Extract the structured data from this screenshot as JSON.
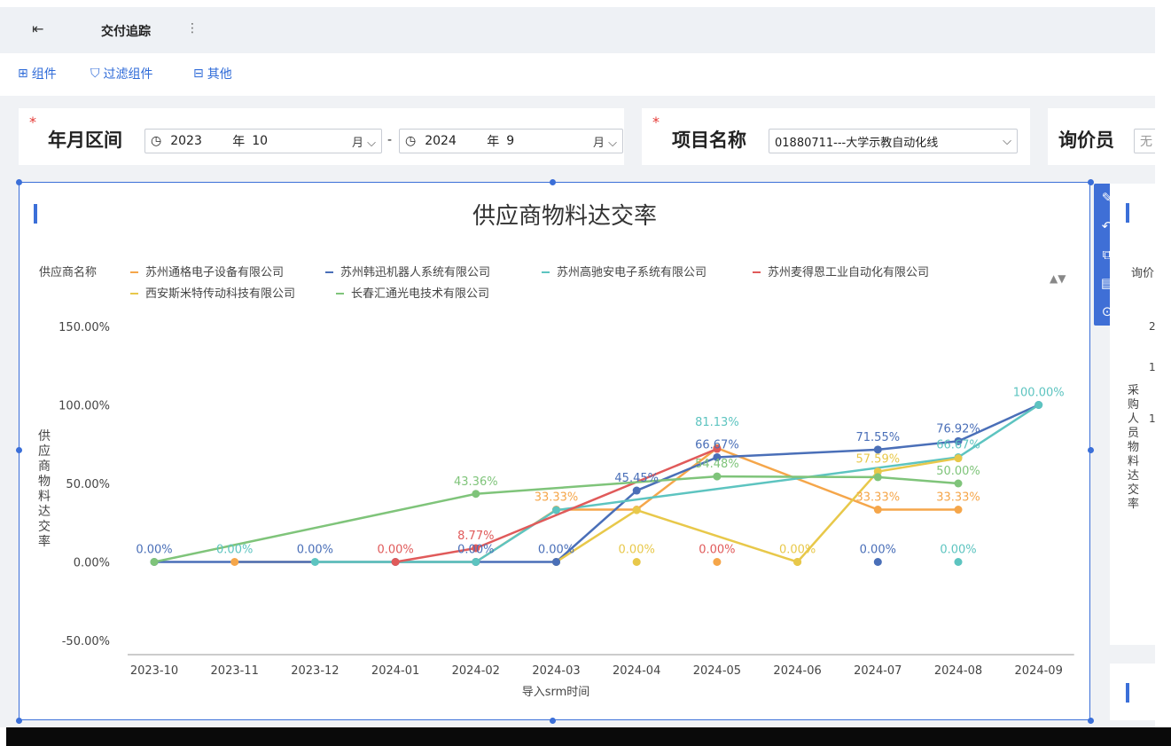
{
  "titlebar": {
    "back_icon": "exit-icon",
    "tab": "交付追踪",
    "more": "⋮"
  },
  "toolbar": {
    "items": [
      "组件",
      "过滤组件",
      "其他"
    ]
  },
  "filters": {
    "date": {
      "label": "年月区间",
      "start_year": "2023",
      "year_unit": "年",
      "start_month": "10",
      "month_unit": "月",
      "separator": "-",
      "end_year": "2024",
      "end_month": "9"
    },
    "project": {
      "label": "项目名称",
      "value": "01880711---大学示教自动化线"
    },
    "inquirer": {
      "label": "询价员",
      "placeholder": "无"
    }
  },
  "side_tools": [
    "edit-icon",
    "undo-icon",
    "copy-icon",
    "comment-icon",
    "collapse-icon"
  ],
  "right_card": {
    "label_short": "询价",
    "vertical_label": "采购人员物料达交率",
    "ticks": [
      "2",
      "1",
      "1"
    ]
  },
  "chart_data": {
    "type": "line",
    "title": "供应商物料达交率",
    "legend_title": "供应商名称",
    "xlabel": "导入srm时间",
    "ylabel": "供应商物料达交率",
    "categories": [
      "2023-10",
      "2023-11",
      "2023-12",
      "2024-01",
      "2024-02",
      "2024-03",
      "2024-04",
      "2024-05",
      "2024-06",
      "2024-07",
      "2024-08",
      "2024-09"
    ],
    "yticks": [
      "150.00%",
      "100.00%",
      "50.00%",
      "0.00%",
      "-50.00%"
    ],
    "ylim": [
      -50,
      150
    ],
    "grid": false,
    "legend_position": "top",
    "series": [
      {
        "name": "苏州通格电子设备有限公司",
        "color": "#f5a64a",
        "values": [
          null,
          0,
          null,
          null,
          0,
          33.33,
          33.33,
          72.5,
          null,
          33.33,
          33.33,
          null
        ]
      },
      {
        "name": "苏州韩迅机器人系统有限公司",
        "color": "#4a6fb8",
        "values": [
          0,
          null,
          null,
          0,
          0,
          0,
          45.45,
          66.67,
          null,
          71.55,
          76.92,
          100
        ]
      },
      {
        "name": "苏州高驰安电子系统有限公司",
        "color": "#5dc4c0",
        "values": [
          null,
          null,
          0,
          null,
          0,
          33.0,
          null,
          null,
          null,
          null,
          66.67,
          100
        ]
      },
      {
        "name": "苏州麦得恩工业自动化有限公司",
        "color": "#e05a5a",
        "values": [
          null,
          null,
          null,
          0,
          8.77,
          null,
          null,
          72.0,
          null,
          null,
          null,
          null
        ]
      },
      {
        "name": "西安斯米特传动科技有限公司",
        "color": "#e8c84a",
        "values": [
          null,
          null,
          null,
          null,
          null,
          0,
          33.0,
          null,
          0,
          57.59,
          66.0,
          null
        ]
      },
      {
        "name": "长春汇通光电技术有限公司",
        "color": "#7fc47a",
        "values": [
          0,
          null,
          null,
          null,
          43.36,
          null,
          null,
          54.48,
          null,
          54.0,
          50.0,
          null
        ]
      }
    ],
    "point_labels": [
      {
        "category": "2023-10",
        "value": 0,
        "text": "0.00%",
        "color": "#4a6fb8"
      },
      {
        "category": "2023-11",
        "value": 0,
        "text": "0.00%",
        "color": "#5dc4c0"
      },
      {
        "category": "2023-12",
        "value": 0,
        "text": "0.00%",
        "color": "#4a6fb8"
      },
      {
        "category": "2024-01",
        "value": 0,
        "text": "0.00%",
        "color": "#e05a5a"
      },
      {
        "category": "2024-02",
        "value": 0,
        "text": "0.00%",
        "color": "#4a6fb8"
      },
      {
        "category": "2024-02",
        "value": 8.77,
        "text": "8.77%",
        "color": "#e05a5a"
      },
      {
        "category": "2024-02",
        "value": 43.36,
        "text": "43.36%",
        "color": "#7fc47a"
      },
      {
        "category": "2024-03",
        "value": 0,
        "text": "0.00%",
        "color": "#4a6fb8"
      },
      {
        "category": "2024-03",
        "value": 33.33,
        "text": "33.33%",
        "color": "#f5a64a"
      },
      {
        "category": "2024-04",
        "value": 0,
        "text": "0.00%",
        "color": "#e8c84a"
      },
      {
        "category": "2024-04",
        "value": 45.45,
        "text": "45.45%",
        "color": "#4a6fb8"
      },
      {
        "category": "2024-05",
        "value": 0,
        "text": "0.00%",
        "color": "#e05a5a"
      },
      {
        "category": "2024-05",
        "value": 81.13,
        "text": "81.13%",
        "color": "#5dc4c0"
      },
      {
        "category": "2024-05",
        "value": 66.67,
        "text": "66.67%",
        "color": "#4a6fb8"
      },
      {
        "category": "2024-05",
        "value": 54.48,
        "text": "54.48%",
        "color": "#7fc47a"
      },
      {
        "category": "2024-06",
        "value": 0,
        "text": "0.00%",
        "color": "#e8c84a"
      },
      {
        "category": "2024-07",
        "value": 0,
        "text": "0.00%",
        "color": "#4a6fb8"
      },
      {
        "category": "2024-07",
        "value": 71.55,
        "text": "71.55%",
        "color": "#4a6fb8"
      },
      {
        "category": "2024-07",
        "value": 57.59,
        "text": "57.59%",
        "color": "#e8c84a"
      },
      {
        "category": "2024-07",
        "value": 33.33,
        "text": "33.33%",
        "color": "#f5a64a"
      },
      {
        "category": "2024-08",
        "value": 0,
        "text": "0.00%",
        "color": "#5dc4c0"
      },
      {
        "category": "2024-08",
        "value": 76.92,
        "text": "76.92%",
        "color": "#4a6fb8"
      },
      {
        "category": "2024-08",
        "value": 66.67,
        "text": "66.67%",
        "color": "#5dc4c0"
      },
      {
        "category": "2024-08",
        "value": 50.0,
        "text": "50.00%",
        "color": "#7fc47a"
      },
      {
        "category": "2024-08",
        "value": 33.33,
        "text": "33.33%",
        "color": "#f5a64a"
      },
      {
        "category": "2024-09",
        "value": 100,
        "text": "100.00%",
        "color": "#5dc4c0"
      }
    ],
    "extra_points": [
      {
        "category": "2024-03",
        "value": 0,
        "color": "#4a6fb8"
      },
      {
        "category": "2024-04",
        "value": 0,
        "color": "#e8c84a"
      },
      {
        "category": "2024-05",
        "value": 0,
        "color": "#f5a64a"
      },
      {
        "category": "2024-06",
        "value": 0,
        "color": "#e8c84a"
      },
      {
        "category": "2024-07",
        "value": 0,
        "color": "#4a6fb8"
      },
      {
        "category": "2024-08",
        "value": 0,
        "color": "#5dc4c0"
      }
    ]
  }
}
